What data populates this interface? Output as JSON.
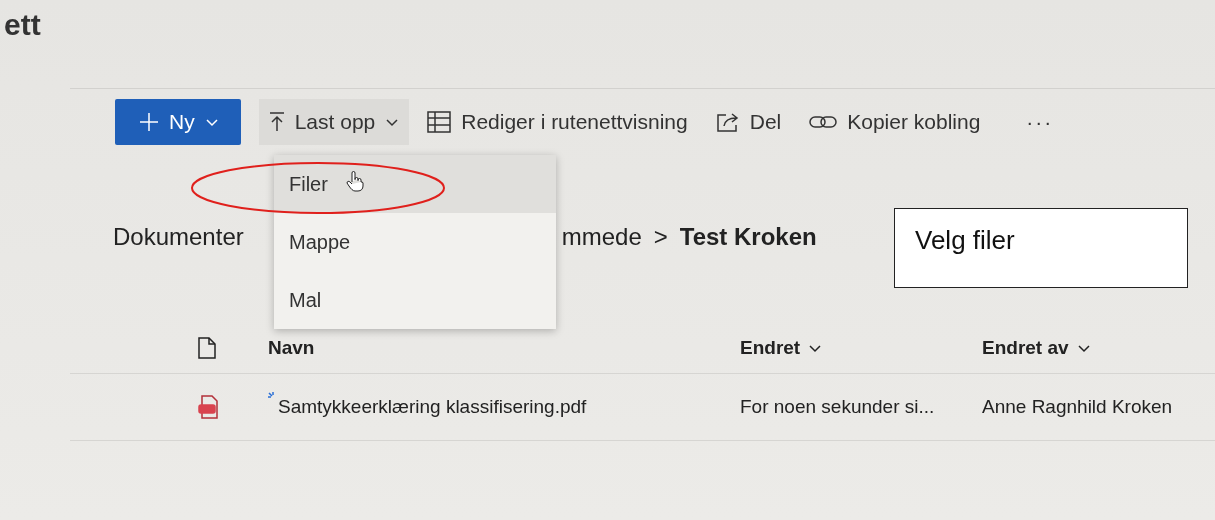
{
  "page_title": "ett",
  "toolbar": {
    "new_button": {
      "label": "Ny"
    },
    "upload_button": {
      "label": "Last opp",
      "expanded": true
    },
    "actions": [
      {
        "kind": "grid",
        "label": "Rediger i rutenettvisning"
      },
      {
        "kind": "share",
        "label": "Del"
      },
      {
        "kind": "link",
        "label": "Kopier kobling"
      }
    ],
    "more": "···"
  },
  "upload_menu": {
    "items": [
      {
        "label": "Filer",
        "selected": true
      },
      {
        "label": "Mappe",
        "selected": false
      },
      {
        "label": "Mal",
        "selected": false
      }
    ]
  },
  "breadcrumb": {
    "items": [
      "Dokumenter",
      "mmede"
    ],
    "separator": ">",
    "current": "Test Kroken"
  },
  "callout": "Velg filer",
  "table": {
    "columns": [
      {
        "label": "Navn",
        "sortable": false
      },
      {
        "label": "Endret",
        "sortable": true
      },
      {
        "label": "Endret av",
        "sortable": true
      }
    ],
    "rows": [
      {
        "name": "Samtykkeerklæring klassifisering.pdf",
        "new": true,
        "modified": "For noen sekunder si...",
        "modified_by": "Anne Ragnhild Kroken"
      }
    ]
  }
}
